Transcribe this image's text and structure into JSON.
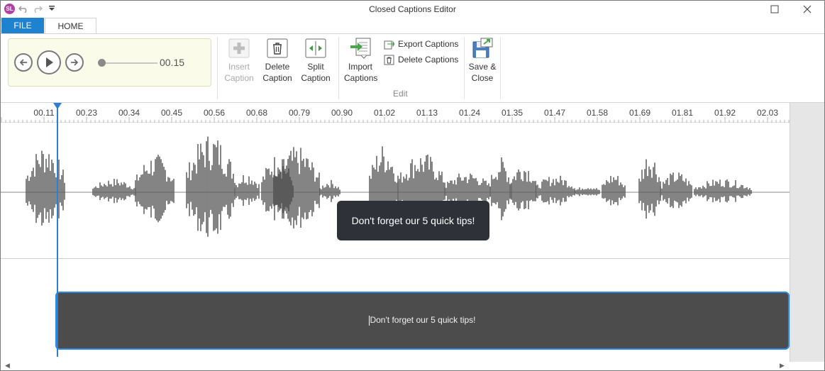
{
  "app": {
    "logo_text": "SL",
    "title": "Closed Captions Editor"
  },
  "tabs": [
    {
      "label": "FILE"
    },
    {
      "label": "HOME"
    }
  ],
  "player": {
    "time": "00.15",
    "position_fraction": 0.07
  },
  "ribbon": {
    "insert_caption": "Insert\nCaption",
    "delete_caption": "Delete\nCaption",
    "split_caption": "Split\nCaption",
    "import_captions": "Import\nCaptions",
    "export_captions": "Export Captions",
    "delete_captions": "Delete Captions",
    "group_edit": "Edit",
    "save_close": "Save &\nClose"
  },
  "ruler": {
    "labels": [
      "00.11",
      "00.23",
      "00.34",
      "00.45",
      "00.56",
      "00.68",
      "00.79",
      "00.90",
      "01.02",
      "01.13",
      "01.24",
      "01.35",
      "01.47",
      "01.58",
      "01.69",
      "01.81",
      "01.92",
      "02.03"
    ]
  },
  "caption": {
    "bubble_text": "Don't forget our 5 quick tips!",
    "track_text": "Don't forget our 5 quick tips!"
  },
  "colors": {
    "accent": "#1e82cf",
    "playhead": "#2c7fd6",
    "waveform": "#5a5a5a",
    "caption_bg": "#4c4c4c"
  }
}
